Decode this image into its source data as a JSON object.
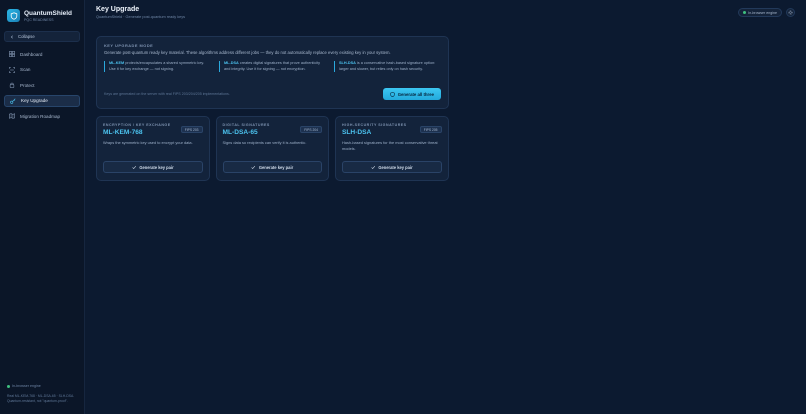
{
  "brand": {
    "name": "QuantumShield",
    "subtitle": "PQC READINESS"
  },
  "sidebar": {
    "collapse_label": "Collapse",
    "items": [
      {
        "label": "Dashboard",
        "icon": "grid-icon"
      },
      {
        "label": "Scan",
        "icon": "scan-icon"
      },
      {
        "label": "Protect",
        "icon": "lock-icon"
      },
      {
        "label": "Key Upgrade",
        "icon": "key-icon",
        "active": true
      },
      {
        "label": "Migration Roadmap",
        "icon": "roadmap-icon"
      }
    ],
    "footer_status": "In-browser engine",
    "footer_note": "Real ML-KEM-768 · ML-DSA-65 · SLH-DSA. Quantum-resistant, not \"quantum-proof\"."
  },
  "header": {
    "title": "Key Upgrade",
    "subtitle": "QuantumShield · Generate post-quantum ready keys",
    "engine_label": "In-browser engine"
  },
  "mode_panel": {
    "label": "KEY UPGRADE MODE",
    "description": "Generate post-quantum ready key material. These algorithms address different jobs — they do not automatically replace every existing key in your system.",
    "notes": [
      {
        "name": "ML-KEM",
        "text": " protects/encapsulates a shared symmetric key. Use it for key exchange — not signing."
      },
      {
        "name": "ML-DSA",
        "text": " creates digital signatures that prove authenticity and integrity. Use it for signing — not encryption."
      },
      {
        "name": "SLH-DSA",
        "text": " is a conservative hash-based signature option: larger and slower, but relies only on hash security."
      }
    ],
    "footer_text": "Keys are generated on the server with real FIPS 203/204/205 implementations.",
    "generate_all_label": "Generate all three"
  },
  "cards": [
    {
      "category": "ENCRYPTION / KEY EXCHANGE",
      "name": "ML-KEM-768",
      "fips": "FIPS 203",
      "description": "Wraps the symmetric key used to encrypt your data.",
      "button": "Generate key pair"
    },
    {
      "category": "DIGITAL SIGNATURES",
      "name": "ML-DSA-65",
      "fips": "FIPS 204",
      "description": "Signs data so recipients can verify it is authentic.",
      "button": "Generate key pair"
    },
    {
      "category": "HIGH-SECURITY SIGNATURES",
      "name": "SLH-DSA",
      "fips": "FIPS 205",
      "description": "Hash-based signatures for the most conservative threat models.",
      "button": "Generate key pair"
    }
  ]
}
